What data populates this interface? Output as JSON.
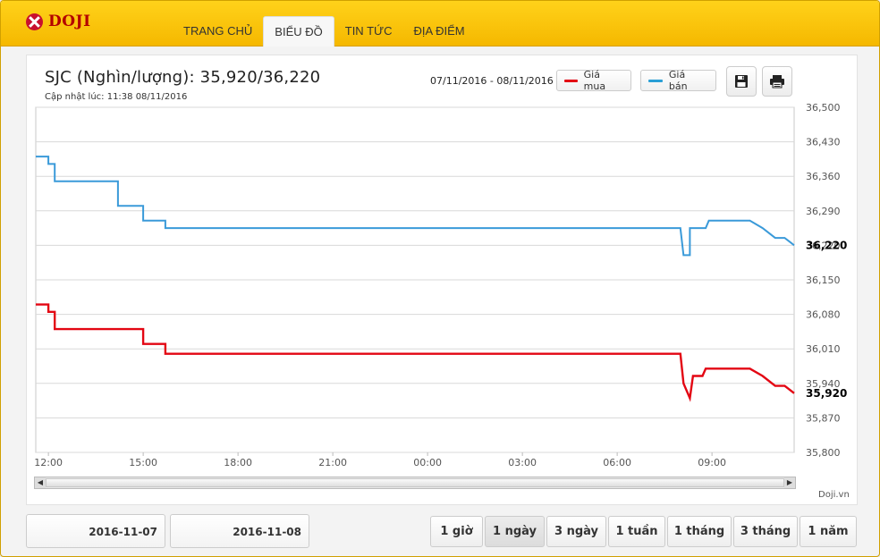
{
  "brand": {
    "name": "DOJI"
  },
  "nav": [
    "TRANG CHỦ",
    "BIỂU ĐỒ",
    "TIN TỨC",
    "ĐỊA ĐIỂM"
  ],
  "nav_active": 1,
  "header": {
    "title": "SJC (Nghìn/lượng): 35,920/36,220",
    "updated": "Cập nhật lúc: 11:38 08/11/2016",
    "range": "07/11/2016 - 08/11/2016"
  },
  "legend": [
    {
      "label": "Giá mua",
      "color": "#e30613"
    },
    {
      "label": "Giá bán",
      "color": "#2a9fd6"
    }
  ],
  "icons": {
    "save": "floppy-disk-icon",
    "print": "printer-icon"
  },
  "credit": "Doji.vn",
  "dates": [
    "2016-11-07",
    "2016-11-08"
  ],
  "periods": [
    "1 giờ",
    "1 ngày",
    "3 ngày",
    "1 tuần",
    "1 tháng",
    "3 tháng",
    "1 năm"
  ],
  "period_active": 1,
  "chart_data": {
    "type": "line",
    "x_ticks": [
      "12:00",
      "15:00",
      "18:00",
      "21:00",
      "00:00",
      "03:00",
      "06:00",
      "09:00"
    ],
    "x_tick_hours": [
      12,
      15,
      18,
      21,
      24,
      27,
      30,
      33
    ],
    "x_range": [
      11.6,
      35.6
    ],
    "y_ticks": [
      "36,500",
      "36,430",
      "36,360",
      "36,290",
      "36,220",
      "36,150",
      "36,080",
      "36,010",
      "35,940",
      "35,870",
      "35,800"
    ],
    "ylim": [
      35800,
      36500
    ],
    "grid": true,
    "last_labels": {
      "sell": "36,220",
      "buy": "35,920"
    },
    "series": [
      {
        "name": "Giá bán",
        "color": "#3a9ad9",
        "x": [
          11.6,
          12.0,
          12.0,
          12.2,
          12.2,
          14.2,
          14.2,
          15.0,
          15.0,
          15.7,
          15.7,
          32.0,
          32.0,
          32.1,
          32.3,
          32.3,
          32.4,
          32.5,
          32.7,
          32.8,
          32.9,
          33.1,
          33.2,
          34.2,
          34.6,
          34.6,
          35.0,
          35.0,
          35.3,
          35.5,
          35.6
        ],
        "y": [
          36400,
          36400,
          36385,
          36385,
          36350,
          36350,
          36300,
          36300,
          36270,
          36270,
          36255,
          36255,
          36255,
          36200,
          36200,
          36255,
          36255,
          36255,
          36255,
          36255,
          36270,
          36270,
          36270,
          36270,
          36255,
          36255,
          36235,
          36235,
          36235,
          36225,
          36220
        ]
      },
      {
        "name": "Giá mua",
        "color": "#e30613",
        "x": [
          11.6,
          12.0,
          12.0,
          12.2,
          12.2,
          14.2,
          14.2,
          15.0,
          15.0,
          15.7,
          15.7,
          32.0,
          32.0,
          32.1,
          32.1,
          32.3,
          32.3,
          32.4,
          32.5,
          32.7,
          32.8,
          32.9,
          33.1,
          34.2,
          34.6,
          34.6,
          35.0,
          35.0,
          35.3,
          35.5,
          35.6
        ],
        "y": [
          36100,
          36100,
          36085,
          36085,
          36050,
          36050,
          36050,
          36050,
          36020,
          36020,
          36000,
          36000,
          36000,
          35940,
          35940,
          35910,
          35910,
          35955,
          35955,
          35955,
          35970,
          35970,
          35970,
          35970,
          35955,
          35955,
          35935,
          35935,
          35935,
          35925,
          35920
        ]
      }
    ]
  }
}
